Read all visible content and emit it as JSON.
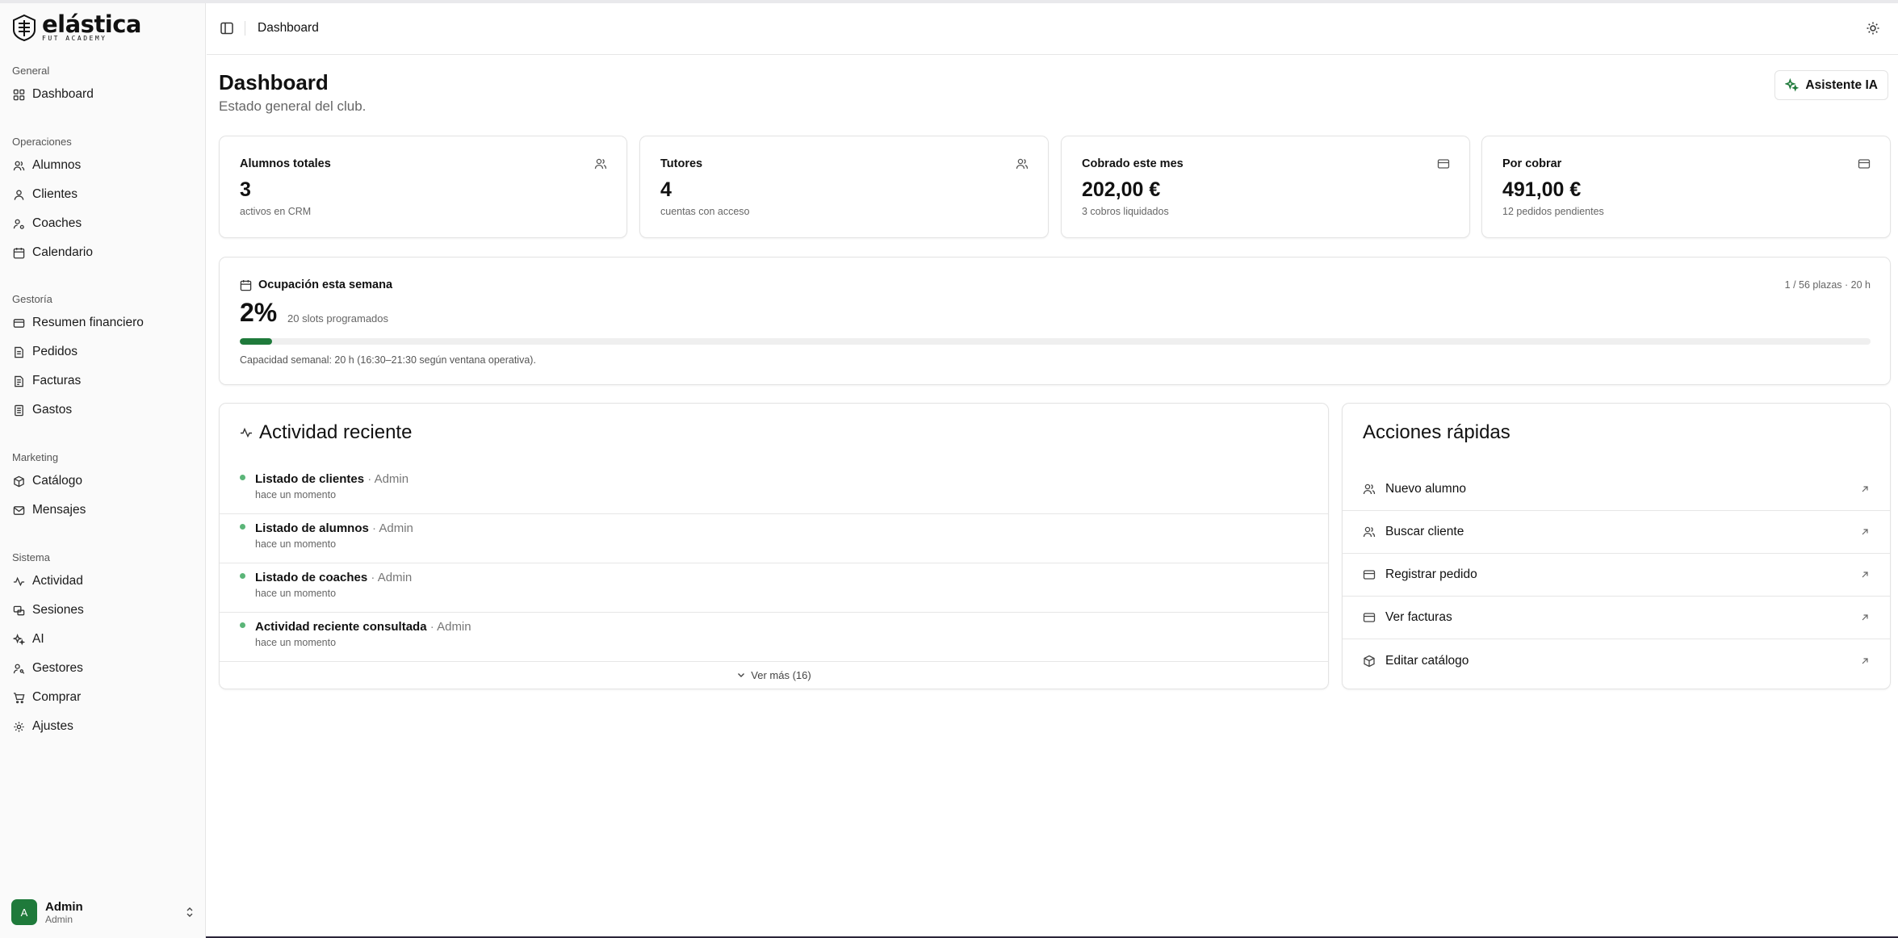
{
  "brand": {
    "name": "elástica",
    "tagline": "FUT ACADEMY"
  },
  "sidebar": {
    "groups": [
      {
        "title": "General",
        "items": [
          {
            "label": "Dashboard",
            "icon": "grid-icon"
          }
        ]
      },
      {
        "title": "Operaciones",
        "items": [
          {
            "label": "Alumnos",
            "icon": "users-icon"
          },
          {
            "label": "Clientes",
            "icon": "user-icon"
          },
          {
            "label": "Coaches",
            "icon": "user-cog-icon"
          },
          {
            "label": "Calendario",
            "icon": "calendar-icon"
          }
        ]
      },
      {
        "title": "Gestoría",
        "items": [
          {
            "label": "Resumen financiero",
            "icon": "card-icon"
          },
          {
            "label": "Pedidos",
            "icon": "document-icon"
          },
          {
            "label": "Facturas",
            "icon": "invoice-icon"
          },
          {
            "label": "Gastos",
            "icon": "receipt-icon"
          }
        ]
      },
      {
        "title": "Marketing",
        "items": [
          {
            "label": "Catálogo",
            "icon": "package-icon"
          },
          {
            "label": "Mensajes",
            "icon": "mail-icon"
          }
        ]
      },
      {
        "title": "Sistema",
        "items": [
          {
            "label": "Actividad",
            "icon": "activity-icon"
          },
          {
            "label": "Sesiones",
            "icon": "sessions-icon"
          },
          {
            "label": "AI",
            "icon": "sparkles-icon"
          },
          {
            "label": "Gestores",
            "icon": "user-key-icon"
          },
          {
            "label": "Comprar",
            "icon": "cart-icon"
          },
          {
            "label": "Ajustes",
            "icon": "gear-icon"
          }
        ]
      }
    ],
    "user": {
      "initial": "A",
      "name": "Admin",
      "role": "Admin"
    }
  },
  "topbar": {
    "breadcrumb": "Dashboard"
  },
  "header": {
    "title": "Dashboard",
    "subtitle": "Estado general del club.",
    "ai_button": "Asistente IA"
  },
  "stats": [
    {
      "label": "Alumnos totales",
      "value": "3",
      "hint": "activos en CRM",
      "icon": "users-icon"
    },
    {
      "label": "Tutores",
      "value": "4",
      "hint": "cuentas con acceso",
      "icon": "users-icon"
    },
    {
      "label": "Cobrado este mes",
      "value": "202,00 €",
      "hint": "3 cobros liquidados",
      "icon": "card-icon"
    },
    {
      "label": "Por cobrar",
      "value": "491,00 €",
      "hint": "12 pedidos pendientes",
      "icon": "card-icon"
    }
  ],
  "occupancy": {
    "title": "Ocupación esta semana",
    "summary": "1 / 56 plazas · 20 h",
    "percent": "2%",
    "percent_value": 0.02,
    "slots": "20 slots programados",
    "capacity_note": "Capacidad semanal: 20 h (16:30–21:30 según ventana operativa)."
  },
  "activity": {
    "title": "Actividad reciente",
    "items": [
      {
        "title": "Listado de clientes",
        "user": "Admin",
        "time": "hace un momento"
      },
      {
        "title": "Listado de alumnos",
        "user": "Admin",
        "time": "hace un momento"
      },
      {
        "title": "Listado de coaches",
        "user": "Admin",
        "time": "hace un momento"
      },
      {
        "title": "Actividad reciente consultada",
        "user": "Admin",
        "time": "hace un momento"
      }
    ],
    "more_label": "Ver más (16)"
  },
  "quick_actions": {
    "title": "Acciones rápidas",
    "items": [
      {
        "label": "Nuevo alumno",
        "icon": "users-icon"
      },
      {
        "label": "Buscar cliente",
        "icon": "users-icon"
      },
      {
        "label": "Registrar pedido",
        "icon": "card-icon"
      },
      {
        "label": "Ver facturas",
        "icon": "card-icon"
      },
      {
        "label": "Editar catálogo",
        "icon": "package-icon"
      }
    ]
  },
  "colors": {
    "accent": "#1f7a3b",
    "dot": "#5bb578"
  }
}
